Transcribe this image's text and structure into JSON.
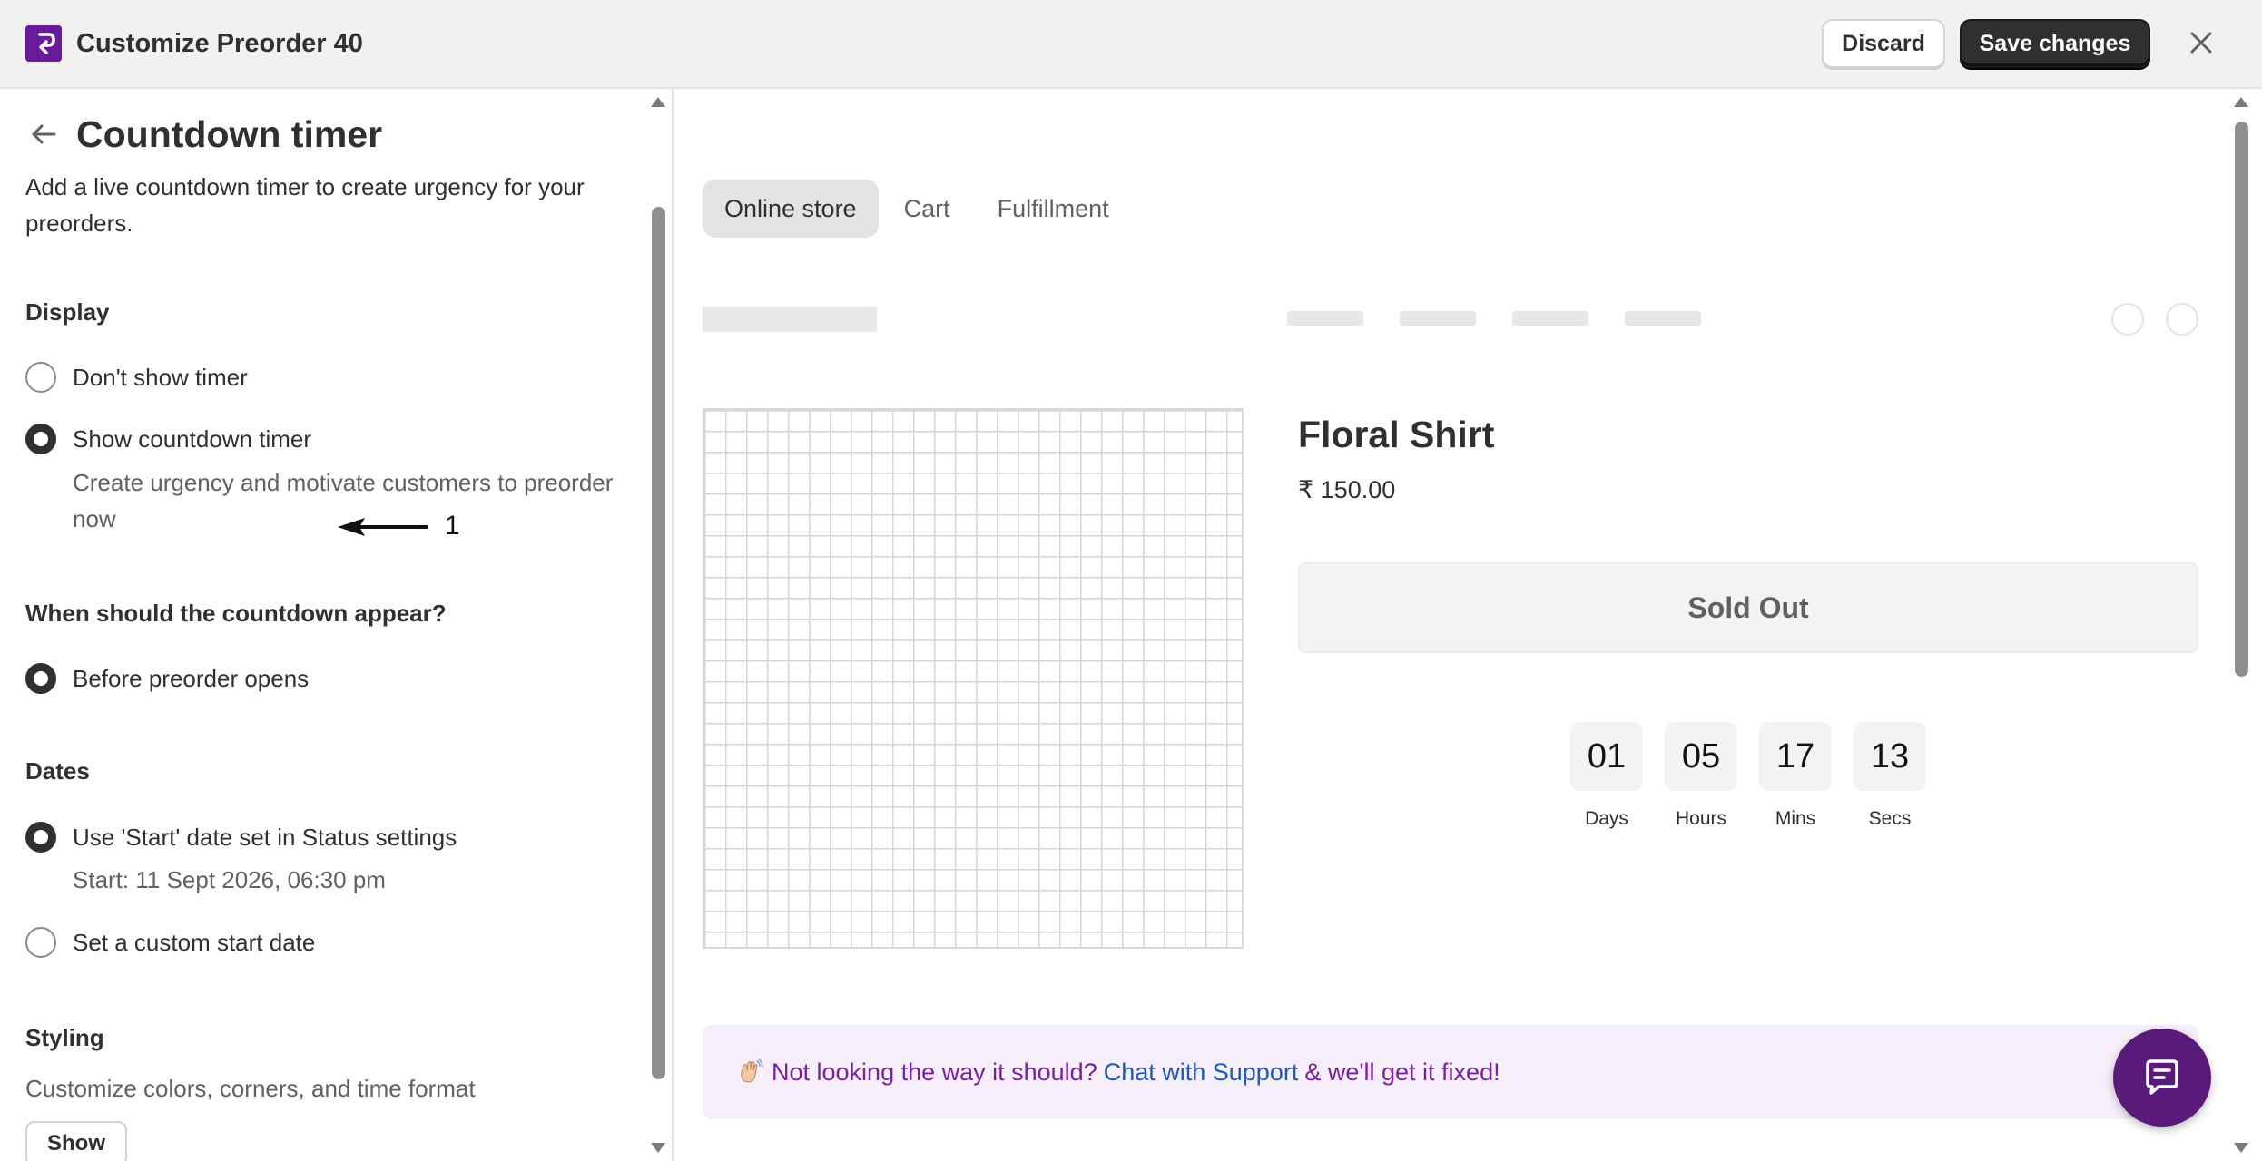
{
  "header": {
    "title": "Customize Preorder 40",
    "discard_label": "Discard",
    "save_label": "Save changes"
  },
  "left_panel": {
    "title": "Countdown timer",
    "description": "Add a live countdown timer to create urgency for your preorders.",
    "display": {
      "label": "Display",
      "options": [
        {
          "label": "Don't show timer",
          "checked": false
        },
        {
          "label": "Show countdown timer",
          "checked": true,
          "help": "Create urgency and motivate customers to preorder now"
        }
      ]
    },
    "annotation_number": "1",
    "when": {
      "label": "When should the countdown appear?",
      "options": [
        {
          "label": "Before preorder opens",
          "checked": true
        }
      ]
    },
    "dates": {
      "label": "Dates",
      "options": [
        {
          "label": "Use 'Start' date set in Status settings",
          "checked": true,
          "help": "Start: 11 Sept 2026, 06:30 pm"
        },
        {
          "label": "Set a custom start date",
          "checked": false
        }
      ]
    },
    "styling": {
      "label": "Styling",
      "description": "Customize colors, corners, and time format",
      "show_button": "Show"
    }
  },
  "preview": {
    "tabs": [
      {
        "label": "Online store",
        "active": true
      },
      {
        "label": "Cart",
        "active": false
      },
      {
        "label": "Fulfillment",
        "active": false
      }
    ],
    "product": {
      "title": "Floral Shirt",
      "price": "₹ 150.00",
      "sold_out_label": "Sold Out"
    },
    "timer": [
      {
        "value": "01",
        "label": "Days"
      },
      {
        "value": "05",
        "label": "Hours"
      },
      {
        "value": "17",
        "label": "Mins"
      },
      {
        "value": "13",
        "label": "Secs"
      }
    ],
    "support_banner": {
      "text_before": "Not looking the way it should?",
      "link": "Chat with Support",
      "text_after": "& we'll get it fixed!"
    }
  },
  "icons": {
    "app_logo": "app-logo-icon",
    "close": "close-icon",
    "back": "arrow-left-icon",
    "wave": "waving-hand-icon",
    "chat": "chat-bubble-icon"
  },
  "colors": {
    "brand": "#6a1b9a",
    "primary_button": "#303030",
    "banner_bg": "#f6eef9",
    "banner_text": "#7a1fa2",
    "link": "#1f5bb5",
    "chat_fab": "#5a1a7a"
  }
}
